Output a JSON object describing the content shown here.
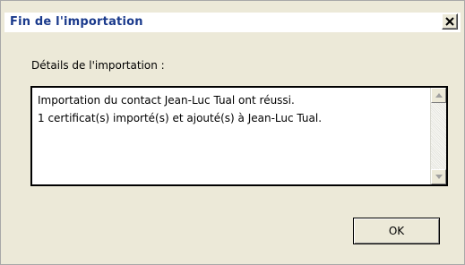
{
  "window": {
    "title": "Fin de l'importation"
  },
  "icons": {
    "close": "close-icon",
    "scroll_up": "scroll-up-arrow-icon",
    "scroll_down": "scroll-down-arrow-icon"
  },
  "details": {
    "label": "Détails de l'importation :",
    "lines": [
      "Importation du contact Jean-Luc Tual ont réussi.",
      "1 certificat(s) importé(s) et ajouté(s) à Jean-Luc Tual."
    ]
  },
  "buttons": {
    "ok_label": "OK"
  },
  "colors": {
    "title_text": "#1a3a8c",
    "dialog_background": "#ece9d8"
  }
}
